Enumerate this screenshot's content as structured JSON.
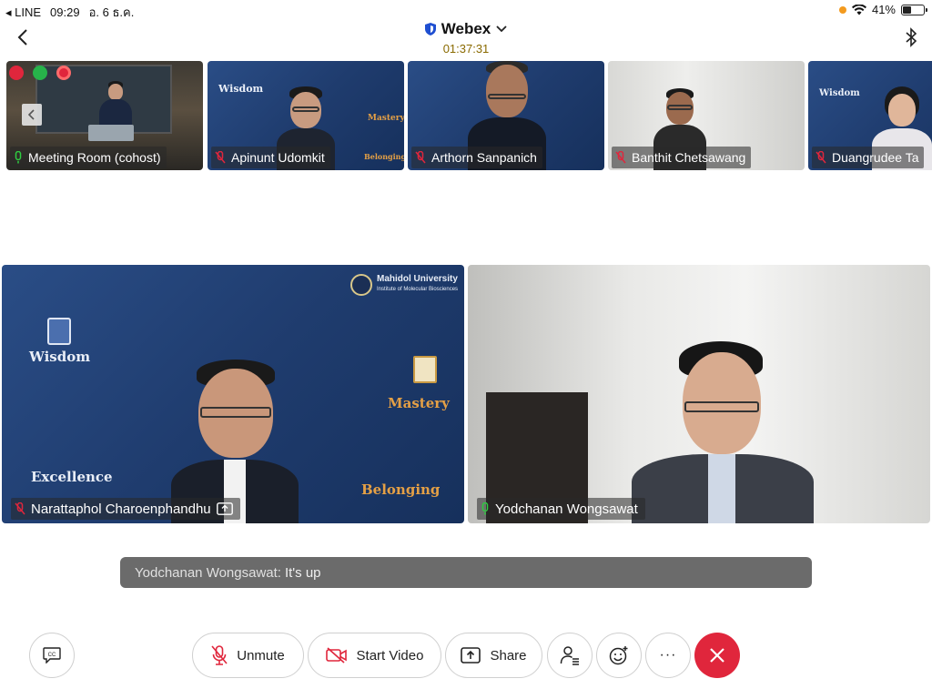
{
  "status_bar": {
    "carrier": "LINE",
    "time": "09:29",
    "date": "อ. 6 ธ.ค.",
    "battery": "41%",
    "battery_level": 0.41
  },
  "header": {
    "app_title": "Webex",
    "call_timer": "01:37:31"
  },
  "thumbnails": [
    {
      "name": "Meeting Room (cohost)",
      "mic": "on"
    },
    {
      "name": "Apinunt Udomkit",
      "mic": "muted"
    },
    {
      "name": "Arthorn Sanpanich",
      "mic": "muted"
    },
    {
      "name": "Banthit Chetsawang",
      "mic": "muted"
    },
    {
      "name": "Duangrudee Ta",
      "mic": "muted"
    }
  ],
  "main_tiles": [
    {
      "name": "Narattaphol Charoenphandhu",
      "mic": "muted",
      "sharing": true
    },
    {
      "name": "Yodchanan Wongsawat",
      "mic": "on",
      "sharing": false
    }
  ],
  "backdrop_text": {
    "wisdom": "Wisdom",
    "excellence": "Excellence",
    "mastery": "Mastery",
    "belonging": "Belonging",
    "university": "Mahidol University",
    "institute": "Institute of Molecular Biosciences"
  },
  "caption": {
    "speaker": "Yodchanan Wongsawat:",
    "text": "It's up"
  },
  "toolbar": {
    "unmute_label": "Unmute",
    "start_video_label": "Start Video",
    "share_label": "Share",
    "more_label": "···"
  },
  "colors": {
    "end_call": "#e0263c",
    "muted_mic": "#e0263c",
    "active_mic": "#2ecc40",
    "timer": "#8a6a00"
  },
  "icons": [
    "back-icon",
    "shield-icon",
    "chevron-down-icon",
    "bluetooth-icon",
    "wifi-icon",
    "cc-icon",
    "mic-muted-icon",
    "video-off-icon",
    "share-icon",
    "participants-icon",
    "reactions-icon",
    "more-icon",
    "end-call-icon"
  ]
}
